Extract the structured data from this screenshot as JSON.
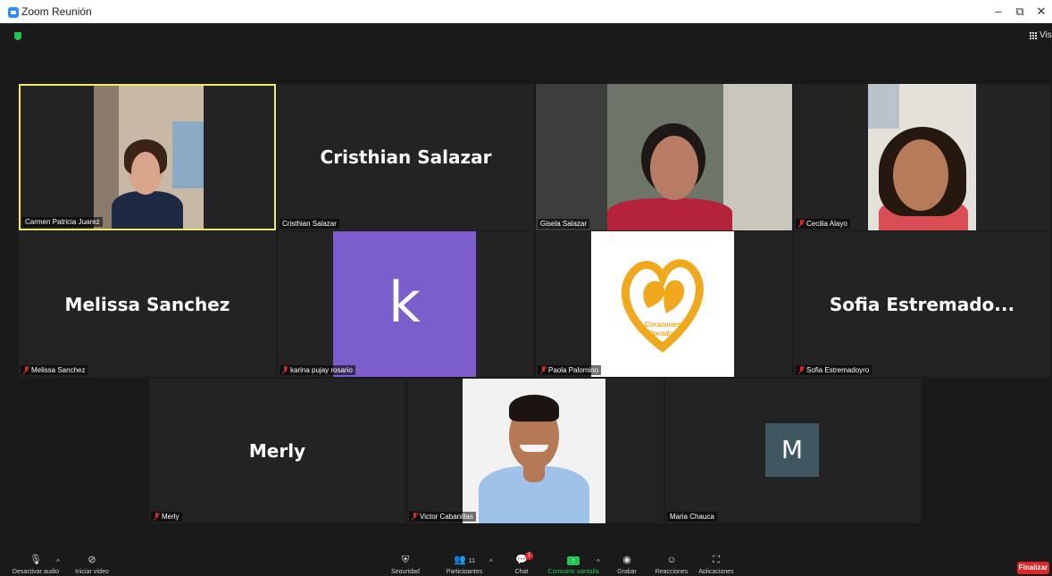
{
  "window": {
    "title": "Zoom Reunión",
    "minimize": "–",
    "restore": "⧉",
    "close": "✕"
  },
  "top": {
    "view_label": "Vista"
  },
  "participants": [
    {
      "tag": "Carmen Patricia Juarez",
      "muted": false,
      "active": true,
      "type": "video"
    },
    {
      "tag": "Cristhian Salazar",
      "display": "Cristhian Salazar",
      "muted": false,
      "type": "name"
    },
    {
      "tag": "Gisela Salazar",
      "muted": false,
      "type": "video"
    },
    {
      "tag": "Cecilia Alayo",
      "muted": true,
      "type": "video"
    },
    {
      "tag": "Melissa Sanchez",
      "display": "Melissa Sanchez",
      "muted": true,
      "type": "name"
    },
    {
      "tag": "karina pujay rosario",
      "avatar_letter": "k",
      "muted": true,
      "type": "avatar",
      "avatar_color": "#7b5dcb"
    },
    {
      "tag": "Paola Palomino",
      "muted": true,
      "type": "logo",
      "logo_text_1": "Corazones",
      "logo_text_2": "Dorados"
    },
    {
      "tag": "Sofia Estremadoyro",
      "display": "Sofia  Estremado...",
      "muted": true,
      "type": "name"
    },
    {
      "tag": "Merly",
      "display": "Merly",
      "muted": true,
      "type": "name"
    },
    {
      "tag": "Victor Cabanillas",
      "muted": true,
      "type": "video"
    },
    {
      "tag": "Maria Chauca",
      "avatar_letter": "M",
      "muted": false,
      "type": "avatar",
      "avatar_color": "#3e5760"
    }
  ],
  "toolbar": {
    "mute_label": "Desactivar audio",
    "video_label": "Iniciar vídeo",
    "security_label": "Seguridad",
    "participants_label": "Participantes",
    "participants_count": "11",
    "chat_label": "Chat",
    "chat_badge": "1",
    "share_label": "Compartir pantalla",
    "record_label": "Grabar",
    "reactions_label": "Reacciones",
    "apps_label": "Aplicaciones",
    "end_label": "Finalizar"
  },
  "colors": {
    "active_speaker_border": "#f3e96a",
    "end_button": "#e02828",
    "share_green": "#23c552",
    "logo_gold": "#f0a81c"
  }
}
